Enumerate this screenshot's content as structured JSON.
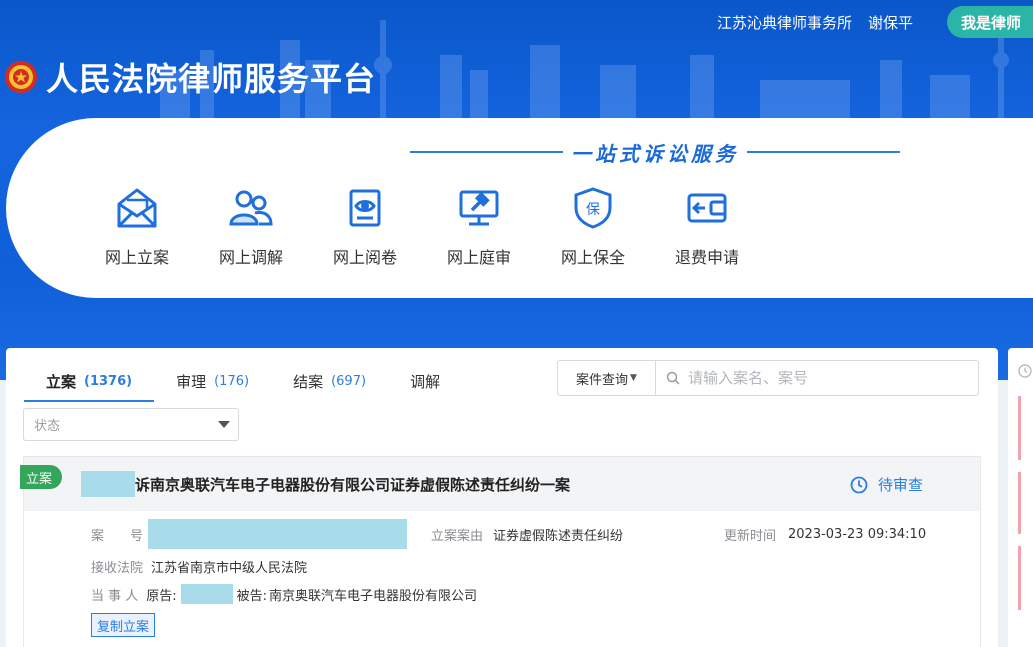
{
  "header": {
    "firm": "江苏沁典律师事务所",
    "user": "谢保平",
    "role_button": "我是律师",
    "site_title": "人民法院律师服务平台",
    "slogan": "一站式诉讼服务"
  },
  "services": [
    {
      "label": "网上立案",
      "icon": "envelope-icon"
    },
    {
      "label": "网上调解",
      "icon": "people-icon"
    },
    {
      "label": "网上阅卷",
      "icon": "document-eye-icon"
    },
    {
      "label": "网上庭审",
      "icon": "gavel-monitor-icon"
    },
    {
      "label": "网上保全",
      "icon": "shield-bao-icon"
    },
    {
      "label": "退费申请",
      "icon": "wallet-return-icon"
    }
  ],
  "tabs": [
    {
      "label": "立案",
      "count": "(1376)"
    },
    {
      "label": "审理",
      "count": "(176)"
    },
    {
      "label": "结案",
      "count": "(697)"
    },
    {
      "label": "调解",
      "count": ""
    }
  ],
  "search": {
    "type_label": "案件查询",
    "placeholder": "请输入案名、案号"
  },
  "status_filter": {
    "placeholder": "状态"
  },
  "case": {
    "tag": "立案",
    "title": "诉南京奥联汽车电子电器股份有限公司证券虚假陈述责任纠纷一案",
    "status": "待审查",
    "case_no_label": "案　　号",
    "cause_label": "立案案由",
    "cause": "证券虚假陈述责任纠纷",
    "updated_label": "更新时间",
    "updated": "2023-03-23 09:34:10",
    "court_label": "接收法院",
    "court": "江苏省南京市中级人民法院",
    "party_label": "当 事 人",
    "plaintiff_label": "原告:",
    "defendant_label": "被告:",
    "defendant": "南京奥联汽车电子电器股份有限公司",
    "copy_button": "复制立案"
  },
  "colors": {
    "banner": "#1565e0",
    "accent": "#2a7de1",
    "role_button": "#2bb5a6",
    "tag_green": "#33a65b",
    "redaction": "#a8dcea"
  }
}
